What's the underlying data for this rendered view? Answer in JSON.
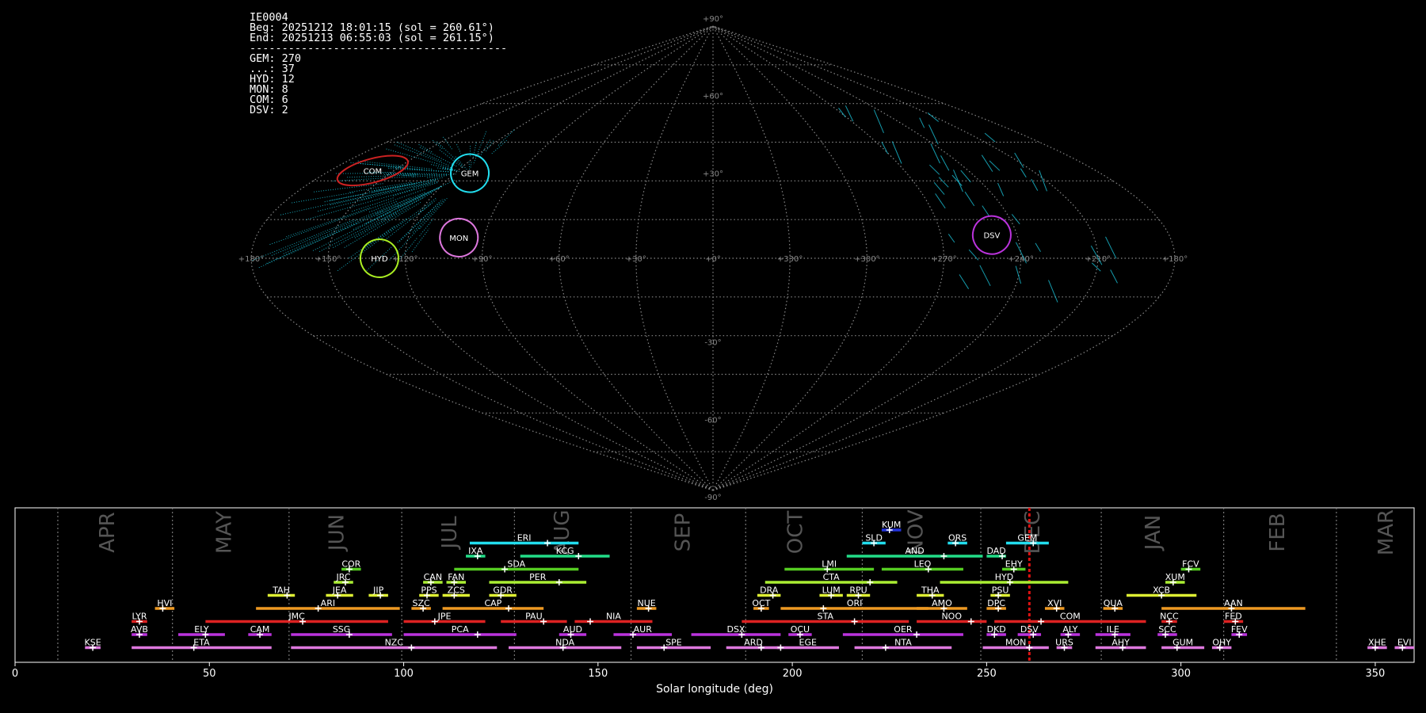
{
  "header": {
    "camera_id": "IE0004",
    "begin": "Beg: 20251212 18:01:15 (sol = 260.61°)",
    "end": "End: 20251213 06:55:03 (sol = 261.15°)",
    "separator": "----------------------------------------",
    "counts": [
      {
        "code": "GEM",
        "count": 270
      },
      {
        "code": "...",
        "count": 37
      },
      {
        "code": "HYD",
        "count": 12
      },
      {
        "code": "MON",
        "count": 8
      },
      {
        "code": "COM",
        "count": 6
      },
      {
        "code": "DSV",
        "count": 2
      }
    ]
  },
  "sky_map": {
    "projection": "sinusoidal",
    "lon_labels": [
      "+180°",
      "+150°",
      "+120°",
      "+90°",
      "+60°",
      "+30°",
      "+0°",
      "+330°",
      "+300°",
      "+270°",
      "+240°",
      "+210°",
      "+180°"
    ],
    "lat_labels": [
      "+90°",
      "+60°",
      "+30°",
      "-30°",
      "-60°",
      "-90°"
    ],
    "radiants": [
      {
        "code": "GEM",
        "lon": 113,
        "lat": 33,
        "color": "#22ddee"
      },
      {
        "code": "COM",
        "lon": 160,
        "lat": 34,
        "color": "#cc2222"
      },
      {
        "code": "MON",
        "lon": 100,
        "lat": 8,
        "color": "#dd77dd"
      },
      {
        "code": "HYD",
        "lon": 130,
        "lat": 0,
        "color": "#aaee22"
      },
      {
        "code": "DSV",
        "lon": 250,
        "lat": 9,
        "color": "#bb33dd"
      }
    ]
  },
  "chart_data": {
    "type": "gantt",
    "xlabel": "Solar longitude (deg)",
    "xlim": [
      0,
      360
    ],
    "xticks": [
      0,
      50,
      100,
      150,
      200,
      250,
      300,
      350
    ],
    "current_sol": 261,
    "months": [
      {
        "name": "APR",
        "start": 11.0,
        "label_at": 24
      },
      {
        "name": "MAY",
        "start": 40.5,
        "label_at": 54
      },
      {
        "name": "JUN",
        "start": 70.5,
        "label_at": 83
      },
      {
        "name": "JUL",
        "start": 99.5,
        "label_at": 112
      },
      {
        "name": "AUG",
        "start": 128.5,
        "label_at": 141
      },
      {
        "name": "SEP",
        "start": 158.5,
        "label_at": 172
      },
      {
        "name": "OCT",
        "start": 188.0,
        "label_at": 201
      },
      {
        "name": "NOV",
        "start": 218.0,
        "label_at": 232
      },
      {
        "name": "DEC",
        "start": 248.5,
        "label_at": 262
      },
      {
        "name": "JAN",
        "start": 279.5,
        "label_at": 293
      },
      {
        "name": "FEB",
        "start": 311.0,
        "label_at": 325
      },
      {
        "name": "MAR",
        "start": 340.0,
        "label_at": 353
      }
    ],
    "showers": [
      {
        "code": "KUM",
        "row": 10,
        "start": 223,
        "end": 228,
        "peak": 225,
        "color": "#2233dd"
      },
      {
        "code": "ERI",
        "row": 9,
        "start": 117,
        "end": 145,
        "peak": 137,
        "color": "#22ddee"
      },
      {
        "code": "SLD",
        "row": 9,
        "start": 218,
        "end": 224,
        "peak": 221,
        "color": "#22ddee"
      },
      {
        "code": "ORS",
        "row": 9,
        "start": 240,
        "end": 245,
        "peak": 242,
        "color": "#22ddee"
      },
      {
        "code": "GEM",
        "row": 9,
        "start": 255,
        "end": 266,
        "peak": 262,
        "color": "#22ddee"
      },
      {
        "code": "IXA",
        "row": 8,
        "start": 116,
        "end": 121,
        "peak": 119,
        "color": "#22dd88"
      },
      {
        "code": "KCG",
        "row": 8,
        "start": 130,
        "end": 153,
        "peak": 145,
        "color": "#22dd88"
      },
      {
        "code": "AND",
        "row": 8,
        "start": 214,
        "end": 249,
        "peak": 239,
        "color": "#22dd88"
      },
      {
        "code": "DAD",
        "row": 8,
        "start": 250,
        "end": 255,
        "peak": 254,
        "color": "#22dd88"
      },
      {
        "code": "COR",
        "row": 7,
        "start": 84,
        "end": 89,
        "peak": 86,
        "color": "#55cc22"
      },
      {
        "code": "SDA",
        "row": 7,
        "start": 113,
        "end": 145,
        "peak": 126,
        "color": "#55cc22"
      },
      {
        "code": "LMI",
        "row": 7,
        "start": 198,
        "end": 221,
        "peak": 209,
        "color": "#55cc22"
      },
      {
        "code": "LEO",
        "row": 7,
        "start": 223,
        "end": 244,
        "peak": 235,
        "color": "#55cc22"
      },
      {
        "code": "EHY",
        "row": 7,
        "start": 254,
        "end": 260,
        "peak": 257,
        "color": "#55cc22"
      },
      {
        "code": "FCV",
        "row": 7,
        "start": 300,
        "end": 305,
        "peak": 302,
        "color": "#55cc22"
      },
      {
        "code": "JRC",
        "row": 6,
        "start": 82,
        "end": 87,
        "peak": 85,
        "color": "#aaee33"
      },
      {
        "code": "CAN",
        "row": 6,
        "start": 105,
        "end": 110,
        "peak": 107,
        "color": "#aaee33"
      },
      {
        "code": "FAN",
        "row": 6,
        "start": 111,
        "end": 116,
        "peak": 113,
        "color": "#aaee33"
      },
      {
        "code": "PER",
        "row": 6,
        "start": 122,
        "end": 147,
        "peak": 140,
        "color": "#aaee33"
      },
      {
        "code": "CTA",
        "row": 6,
        "start": 193,
        "end": 227,
        "peak": 220,
        "color": "#aaee33"
      },
      {
        "code": "HYD",
        "row": 6,
        "start": 238,
        "end": 271,
        "peak": 256,
        "color": "#aaee33"
      },
      {
        "code": "XUM",
        "row": 6,
        "start": 296,
        "end": 301,
        "peak": 298,
        "color": "#aaee33"
      },
      {
        "code": "TAH",
        "row": 5,
        "start": 65,
        "end": 72,
        "peak": 70,
        "color": "#ddee33"
      },
      {
        "code": "JEA",
        "row": 5,
        "start": 80,
        "end": 87,
        "peak": 83,
        "color": "#ddee33"
      },
      {
        "code": "JIP",
        "row": 5,
        "start": 91,
        "end": 96,
        "peak": 94,
        "color": "#ddee33"
      },
      {
        "code": "PPS",
        "row": 5,
        "start": 104,
        "end": 109,
        "peak": 106,
        "color": "#ddee33"
      },
      {
        "code": "ZCS",
        "row": 5,
        "start": 110,
        "end": 117,
        "peak": 113,
        "color": "#ddee33"
      },
      {
        "code": "GDR",
        "row": 5,
        "start": 122,
        "end": 129,
        "peak": 125,
        "color": "#ddee33"
      },
      {
        "code": "DRA",
        "row": 5,
        "start": 191,
        "end": 197,
        "peak": 195,
        "color": "#ddee33"
      },
      {
        "code": "LUM",
        "row": 5,
        "start": 207,
        "end": 213,
        "peak": 210,
        "color": "#ddee33"
      },
      {
        "code": "RPU",
        "row": 5,
        "start": 214,
        "end": 220,
        "peak": 217,
        "color": "#ddee33"
      },
      {
        "code": "THA",
        "row": 5,
        "start": 232,
        "end": 239,
        "peak": 236,
        "color": "#ddee33"
      },
      {
        "code": "PSU",
        "row": 5,
        "start": 251,
        "end": 256,
        "peak": 253,
        "color": "#ddee33"
      },
      {
        "code": "XCB",
        "row": 5,
        "start": 286,
        "end": 304,
        "peak": 295,
        "color": "#ddee33"
      },
      {
        "code": "HVI",
        "row": 4,
        "start": 36,
        "end": 41,
        "peak": 38,
        "color": "#ee9922"
      },
      {
        "code": "ARI",
        "row": 4,
        "start": 62,
        "end": 99,
        "peak": 78,
        "color": "#ee9922"
      },
      {
        "code": "SZC",
        "row": 4,
        "start": 102,
        "end": 107,
        "peak": 105,
        "color": "#ee9922"
      },
      {
        "code": "CAP",
        "row": 4,
        "start": 110,
        "end": 136,
        "peak": 127,
        "color": "#ee9922"
      },
      {
        "code": "NUE",
        "row": 4,
        "start": 160,
        "end": 165,
        "peak": 163,
        "color": "#ee9922"
      },
      {
        "code": "OCT",
        "row": 4,
        "start": 190,
        "end": 194,
        "peak": 192,
        "color": "#ee9922"
      },
      {
        "code": "ORI",
        "row": 4,
        "start": 197,
        "end": 235,
        "peak": 208,
        "color": "#ee9922"
      },
      {
        "code": "AMO",
        "row": 4,
        "start": 232,
        "end": 245,
        "peak": 239,
        "color": "#ee9922"
      },
      {
        "code": "DPC",
        "row": 4,
        "start": 250,
        "end": 255,
        "peak": 253,
        "color": "#ee9922"
      },
      {
        "code": "XVI",
        "row": 4,
        "start": 265,
        "end": 270,
        "peak": 268,
        "color": "#ee9922"
      },
      {
        "code": "QUA",
        "row": 4,
        "start": 280,
        "end": 285,
        "peak": 283,
        "color": "#ee9922"
      },
      {
        "code": "AAN",
        "row": 4,
        "start": 295,
        "end": 332,
        "peak": 313,
        "color": "#ee9922"
      },
      {
        "code": "LYR",
        "row": 3,
        "start": 30,
        "end": 34,
        "peak": 32,
        "color": "#dd2222"
      },
      {
        "code": "JMC",
        "row": 3,
        "start": 49,
        "end": 96,
        "peak": 74,
        "color": "#dd2222"
      },
      {
        "code": "JPE",
        "row": 3,
        "start": 100,
        "end": 121,
        "peak": 108,
        "color": "#dd2222"
      },
      {
        "code": "PAU",
        "row": 3,
        "start": 125,
        "end": 142,
        "peak": 136,
        "color": "#dd2222"
      },
      {
        "code": "NIA",
        "row": 3,
        "start": 144,
        "end": 164,
        "peak": 148,
        "color": "#dd2222"
      },
      {
        "code": "STA",
        "row": 3,
        "start": 187,
        "end": 230,
        "peak": 216,
        "color": "#dd2222"
      },
      {
        "code": "NOO",
        "row": 3,
        "start": 232,
        "end": 250,
        "peak": 246,
        "color": "#dd2222"
      },
      {
        "code": "COM",
        "row": 3,
        "start": 252,
        "end": 291,
        "peak": 264,
        "color": "#dd2222"
      },
      {
        "code": "NCC",
        "row": 3,
        "start": 295,
        "end": 299,
        "peak": 297,
        "color": "#dd2222"
      },
      {
        "code": "FED",
        "row": 3,
        "start": 311,
        "end": 316,
        "peak": 314,
        "color": "#dd2222"
      },
      {
        "code": "AVB",
        "row": 2,
        "start": 30,
        "end": 34,
        "peak": 32,
        "color": "#bb33dd"
      },
      {
        "code": "ELY",
        "row": 2,
        "start": 42,
        "end": 54,
        "peak": 49,
        "color": "#bb33dd"
      },
      {
        "code": "CAM",
        "row": 2,
        "start": 60,
        "end": 66,
        "peak": 63,
        "color": "#bb33dd"
      },
      {
        "code": "SSG",
        "row": 2,
        "start": 71,
        "end": 97,
        "peak": 86,
        "color": "#bb33dd"
      },
      {
        "code": "PCA",
        "row": 2,
        "start": 100,
        "end": 129,
        "peak": 119,
        "color": "#bb33dd"
      },
      {
        "code": "AUD",
        "row": 2,
        "start": 140,
        "end": 147,
        "peak": 143,
        "color": "#bb33dd"
      },
      {
        "code": "AUR",
        "row": 2,
        "start": 154,
        "end": 169,
        "peak": 159,
        "color": "#bb33dd"
      },
      {
        "code": "DSX",
        "row": 2,
        "start": 174,
        "end": 197,
        "peak": 187,
        "color": "#bb33dd"
      },
      {
        "code": "OCU",
        "row": 2,
        "start": 199,
        "end": 205,
        "peak": 202,
        "color": "#bb33dd"
      },
      {
        "code": "OER",
        "row": 2,
        "start": 213,
        "end": 244,
        "peak": 232,
        "color": "#bb33dd"
      },
      {
        "code": "DKD",
        "row": 2,
        "start": 250,
        "end": 255,
        "peak": 252,
        "color": "#bb33dd"
      },
      {
        "code": "DSV",
        "row": 2,
        "start": 258,
        "end": 264,
        "peak": 262,
        "color": "#bb33dd"
      },
      {
        "code": "ALY",
        "row": 2,
        "start": 269,
        "end": 274,
        "peak": 271,
        "color": "#bb33dd"
      },
      {
        "code": "ILE",
        "row": 2,
        "start": 278,
        "end": 287,
        "peak": 283,
        "color": "#bb33dd"
      },
      {
        "code": "SCC",
        "row": 2,
        "start": 294,
        "end": 299,
        "peak": 296,
        "color": "#bb33dd"
      },
      {
        "code": "FEV",
        "row": 2,
        "start": 313,
        "end": 317,
        "peak": 315,
        "color": "#bb33dd"
      },
      {
        "code": "KSE",
        "row": 1,
        "start": 18,
        "end": 22,
        "peak": 20,
        "color": "#dd77dd"
      },
      {
        "code": "ETA",
        "row": 1,
        "start": 30,
        "end": 66,
        "peak": 46,
        "color": "#dd77dd"
      },
      {
        "code": "NZC",
        "row": 1,
        "start": 71,
        "end": 124,
        "peak": 102,
        "color": "#dd77dd"
      },
      {
        "code": "NDA",
        "row": 1,
        "start": 127,
        "end": 156,
        "peak": 141,
        "color": "#dd77dd"
      },
      {
        "code": "SPE",
        "row": 1,
        "start": 160,
        "end": 179,
        "peak": 167,
        "color": "#dd77dd"
      },
      {
        "code": "ARD",
        "row": 1,
        "start": 183,
        "end": 197,
        "peak": 192,
        "color": "#dd77dd"
      },
      {
        "code": "EGE",
        "row": 1,
        "start": 196,
        "end": 212,
        "peak": 197,
        "color": "#dd77dd"
      },
      {
        "code": "NTA",
        "row": 1,
        "start": 216,
        "end": 241,
        "peak": 224,
        "color": "#dd77dd"
      },
      {
        "code": "MON",
        "row": 1,
        "start": 249,
        "end": 266,
        "peak": 261,
        "color": "#dd77dd"
      },
      {
        "code": "URS",
        "row": 1,
        "start": 268,
        "end": 272,
        "peak": 270,
        "color": "#dd77dd"
      },
      {
        "code": "AHY",
        "row": 1,
        "start": 278,
        "end": 291,
        "peak": 285,
        "color": "#dd77dd"
      },
      {
        "code": "GUM",
        "row": 1,
        "start": 295,
        "end": 306,
        "peak": 299,
        "color": "#dd77dd"
      },
      {
        "code": "OHY",
        "row": 1,
        "start": 308,
        "end": 313,
        "peak": 310,
        "color": "#dd77dd"
      },
      {
        "code": "XHE",
        "row": 1,
        "start": 348,
        "end": 353,
        "peak": 350,
        "color": "#dd77dd"
      },
      {
        "code": "EVI",
        "row": 1,
        "start": 355,
        "end": 360,
        "peak": 357,
        "color": "#dd77dd"
      }
    ]
  }
}
